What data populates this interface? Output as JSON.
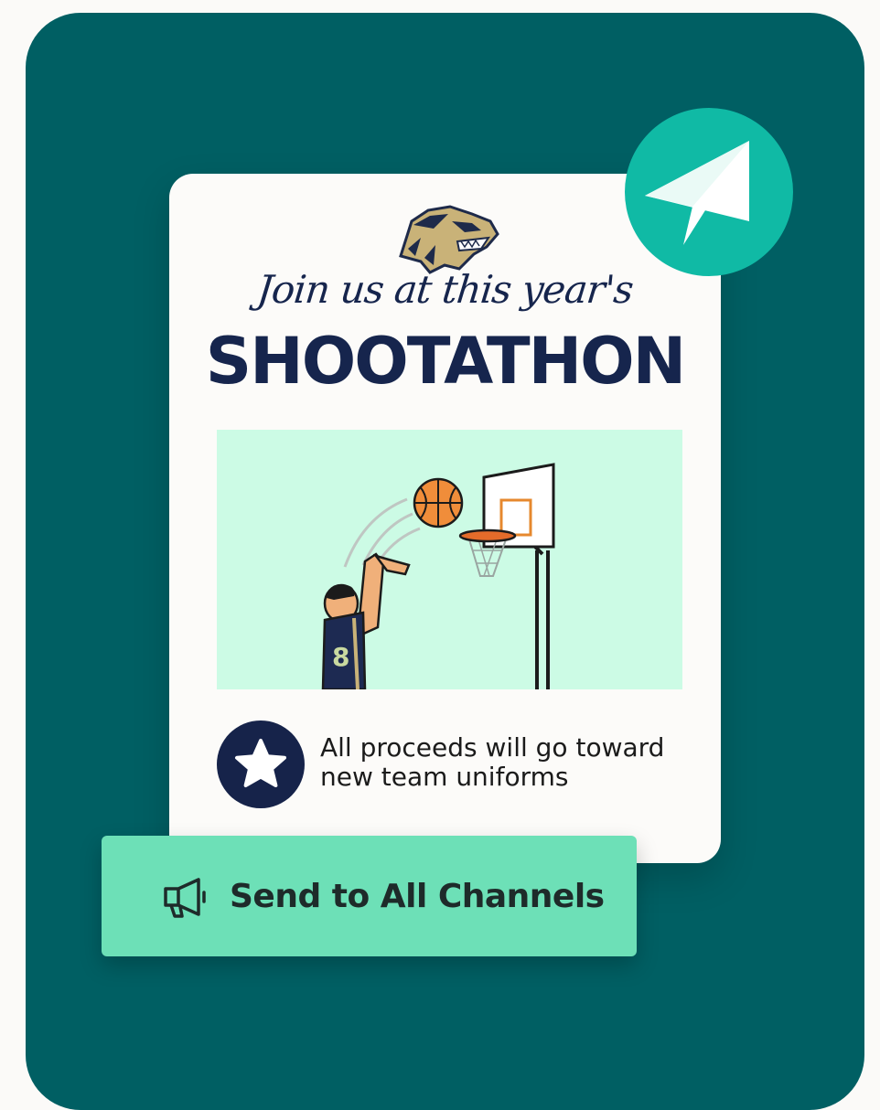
{
  "flyer": {
    "tagline": "Join us at this year's",
    "headline": "SHOOTATHON",
    "note_line1": "All proceeds will go toward",
    "note_line2": "new team uniforms",
    "player_number": "8"
  },
  "actions": {
    "send_label": "Send to All Channels"
  },
  "icons": {
    "mascot": "wolverine-mascot-logo",
    "send": "paper-plane-icon",
    "star": "star-icon",
    "megaphone": "megaphone-icon"
  },
  "colors": {
    "background": "#005f63",
    "card": "#fcfbf9",
    "navy": "#16254d",
    "send_bubble": "#10baa5",
    "button": "#6de0b7",
    "illustration_bg": "#ccfbe5"
  }
}
